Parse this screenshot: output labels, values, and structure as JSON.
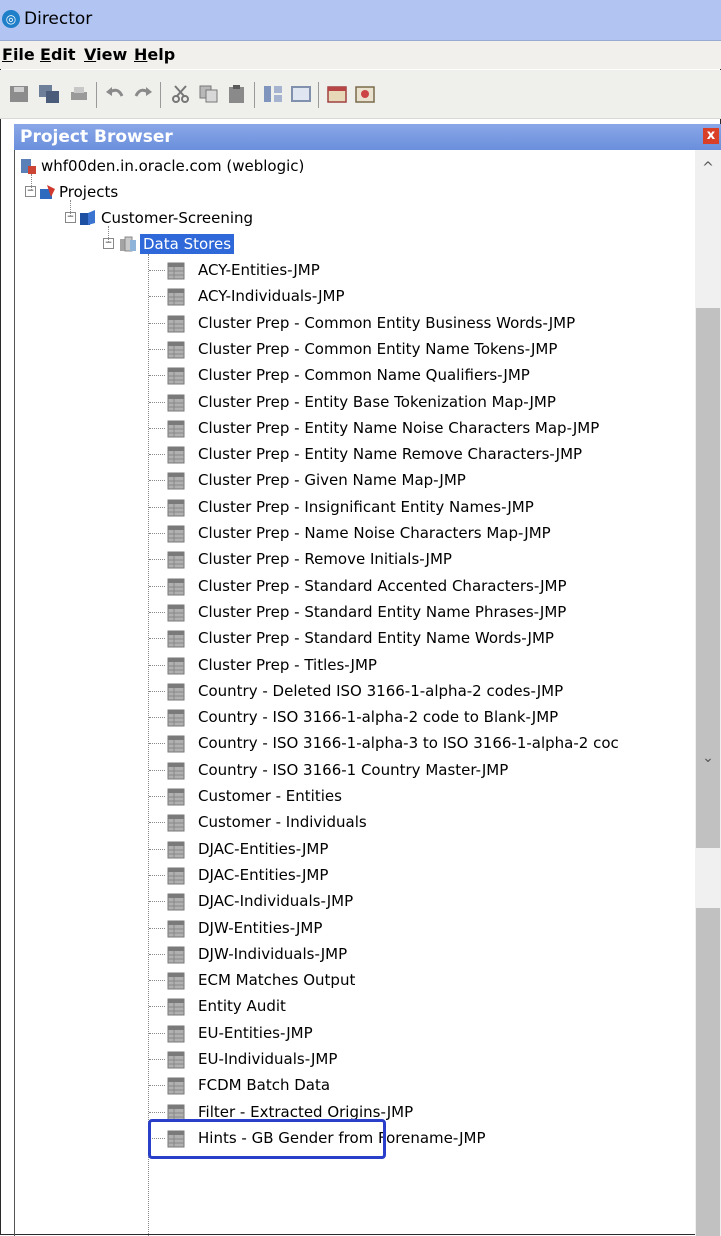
{
  "window": {
    "title": "Director"
  },
  "menu": {
    "file": "File",
    "edit": "Edit",
    "view": "View",
    "help": "Help"
  },
  "toolbar": {
    "icons": [
      "save-icon",
      "save-all-icon",
      "print-icon",
      "undo-icon",
      "redo-icon",
      "cut-icon",
      "copy-icon",
      "paste-icon",
      "layout-icon",
      "window-icon",
      "calendar-icon",
      "preview-icon"
    ]
  },
  "project_browser": {
    "title": "Project Browser",
    "close": "x",
    "server": "whf00den.in.oracle.com (weblogic)",
    "projects": "Projects",
    "project_name": "Customer-Screening",
    "data_stores": "Data Stores",
    "items": [
      "ACY-Entities-JMP",
      "ACY-Individuals-JMP",
      "Cluster Prep - Common Entity Business Words-JMP",
      "Cluster Prep - Common Entity Name Tokens-JMP",
      "Cluster Prep - Common Name Qualifiers-JMP",
      "Cluster Prep - Entity Base Tokenization Map-JMP",
      "Cluster Prep - Entity Name Noise Characters Map-JMP",
      "Cluster Prep - Entity Name Remove Characters-JMP",
      "Cluster Prep - Given Name Map-JMP",
      "Cluster Prep - Insignificant Entity Names-JMP",
      "Cluster Prep - Name Noise Characters Map-JMP",
      "Cluster Prep - Remove Initials-JMP",
      "Cluster Prep - Standard Accented Characters-JMP",
      "Cluster Prep - Standard Entity Name Phrases-JMP",
      "Cluster Prep - Standard Entity Name Words-JMP",
      "Cluster Prep - Titles-JMP",
      "Country - Deleted ISO 3166-1-alpha-2 codes-JMP",
      "Country - ISO 3166-1-alpha-2 code to Blank-JMP",
      "Country - ISO 3166-1-alpha-3 to ISO 3166-1-alpha-2 coc",
      "Country - ISO 3166-1 Country Master-JMP",
      "Customer - Entities",
      "Customer - Individuals",
      "DJAC-Entities-JMP",
      "DJAC-Entities-JMP",
      "DJAC-Individuals-JMP",
      "DJW-Entities-JMP",
      "DJW-Individuals-JMP",
      "ECM Matches Output",
      "Entity Audit",
      "EU-Entities-JMP",
      "EU-Individuals-JMP",
      "FCDM Batch Data",
      "Filter - Extracted Origins-JMP",
      "Hints - GB Gender from Forename-JMP"
    ]
  },
  "colors": {
    "title_bar": "#b2c5f2",
    "panel_header": "#6a8fdc",
    "selection": "#2f68d8",
    "highlight_box": "#2a3fc9"
  }
}
